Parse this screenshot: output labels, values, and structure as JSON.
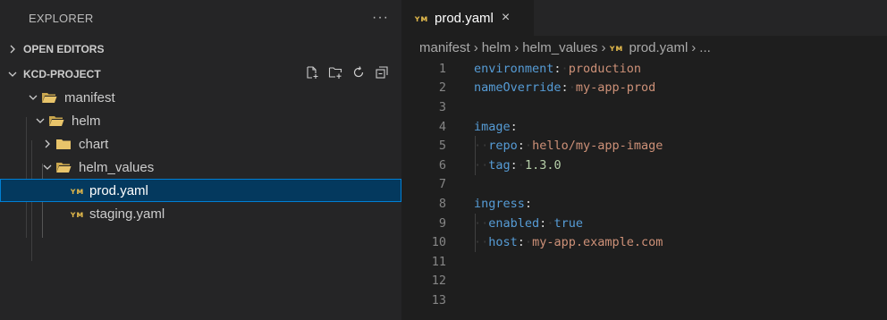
{
  "sidebar": {
    "title": "EXPLORER",
    "more": "···",
    "open_editors": "OPEN EDITORS",
    "project": "KCD-PROJECT",
    "tree": [
      {
        "label": "manifest",
        "type": "folder",
        "open": true
      },
      {
        "label": "helm",
        "type": "folder",
        "open": true
      },
      {
        "label": "chart",
        "type": "folder",
        "open": false
      },
      {
        "label": "helm_values",
        "type": "folder",
        "open": true
      },
      {
        "label": "prod.yaml",
        "type": "yaml",
        "selected": true
      },
      {
        "label": "staging.yaml",
        "type": "yaml",
        "selected": false
      }
    ]
  },
  "editor": {
    "tab": {
      "label": "prod.yaml",
      "close": "×"
    },
    "breadcrumb": [
      "manifest",
      "helm",
      "helm_values",
      "prod.yaml",
      "..."
    ],
    "lines": [
      {
        "num": "1",
        "indent": "",
        "key": "environment",
        "value": "production",
        "vtype": "v"
      },
      {
        "num": "2",
        "indent": "",
        "key": "nameOverride",
        "value": "my-app-prod",
        "vtype": "v"
      },
      {
        "num": "3",
        "indent": "",
        "key": "",
        "value": "",
        "vtype": ""
      },
      {
        "num": "4",
        "indent": "",
        "key": "image",
        "value": "",
        "vtype": ""
      },
      {
        "num": "5",
        "indent": "··",
        "key": "repo",
        "value": "hello/my-app-image",
        "vtype": "v"
      },
      {
        "num": "6",
        "indent": "··",
        "key": "tag",
        "value": "1.3.0",
        "vtype": "n"
      },
      {
        "num": "7",
        "indent": "",
        "key": "",
        "value": "",
        "vtype": ""
      },
      {
        "num": "8",
        "indent": "",
        "key": "ingress",
        "value": "",
        "vtype": ""
      },
      {
        "num": "9",
        "indent": "··",
        "key": "enabled",
        "value": "true",
        "vtype": "k"
      },
      {
        "num": "10",
        "indent": "··",
        "key": "host",
        "value": "my-app.example.com",
        "vtype": "v"
      },
      {
        "num": "11",
        "indent": "",
        "key": "",
        "value": "",
        "vtype": ""
      },
      {
        "num": "12",
        "indent": "",
        "key": "",
        "value": "",
        "vtype": ""
      },
      {
        "num": "13",
        "indent": "",
        "key": "",
        "value": "",
        "vtype": ""
      }
    ]
  },
  "colors": {
    "key": "#569cd6",
    "string": "#ce9178",
    "number": "#b5cea8",
    "selection": "#04395e",
    "selection_border": "#007fd4",
    "folder": "#e8c46a",
    "yaml_icon": "#d9b24a"
  },
  "icons": {
    "new_file": "new-file-icon",
    "new_folder": "new-folder-icon",
    "refresh": "refresh-icon",
    "collapse": "collapse-all-icon",
    "folder": "folder-icon",
    "yaml": "yaml-file-icon",
    "chevron_right": "chevron-right-icon",
    "chevron_down": "chevron-down-icon"
  }
}
